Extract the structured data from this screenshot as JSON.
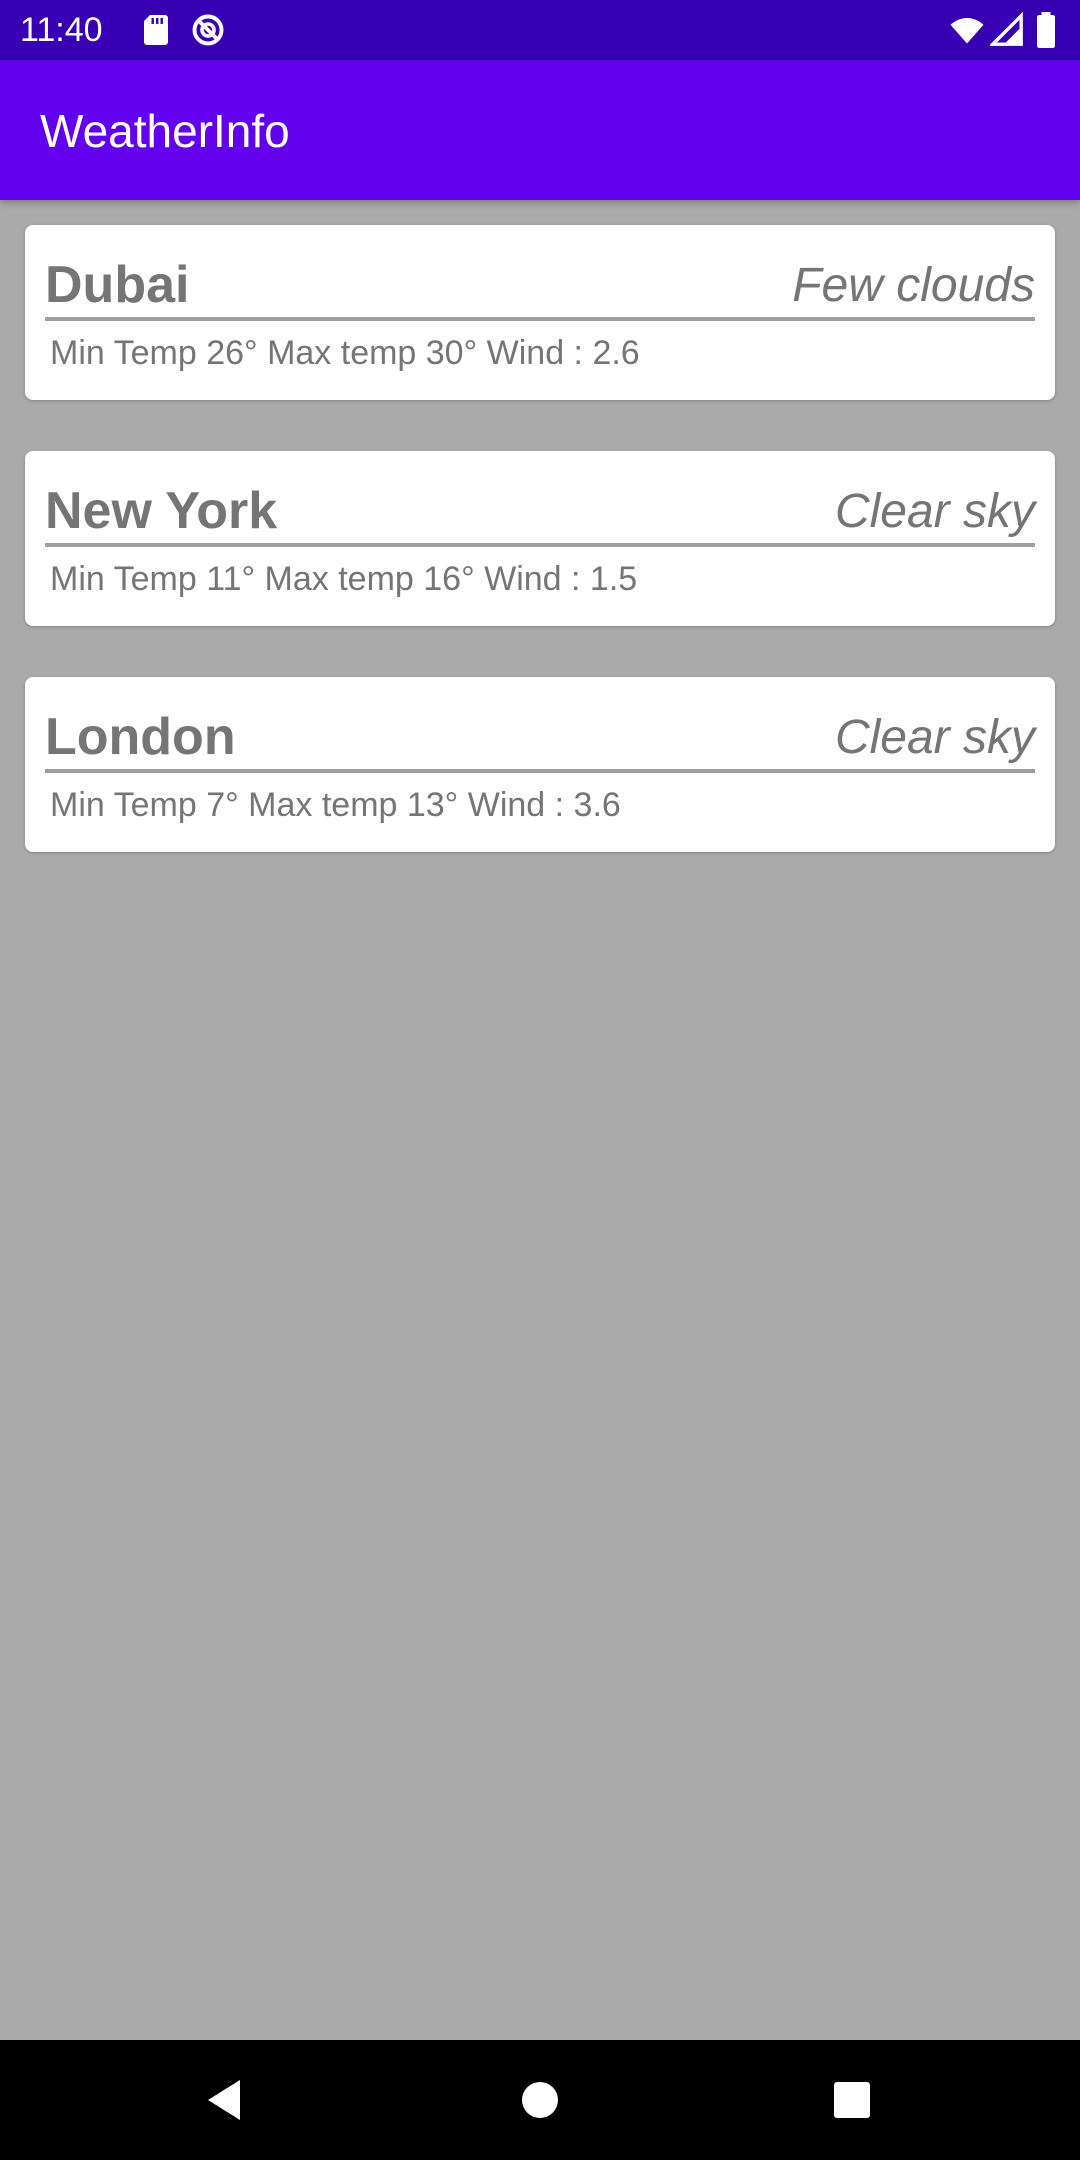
{
  "status_bar": {
    "time": "11:40",
    "left_icons": [
      "sd-card-icon",
      "sync-icon"
    ],
    "right_icons": [
      "wifi-icon",
      "cell-signal-icon",
      "battery-icon"
    ]
  },
  "app_bar": {
    "title": "WeatherInfo"
  },
  "cities": [
    {
      "name": "Dubai",
      "description": "Few clouds",
      "details": "Min Temp 26° Max temp 30° Wind : 2.6"
    },
    {
      "name": "New York",
      "description": "Clear sky",
      "details": "Min Temp 11° Max temp 16° Wind : 1.5"
    },
    {
      "name": "London",
      "description": "Clear sky",
      "details": "Min Temp 7° Max temp 13° Wind : 3.6"
    }
  ],
  "nav_bar": {
    "buttons": [
      "back-icon",
      "home-icon",
      "recents-icon"
    ]
  },
  "colors": {
    "status_bar": "#3700b3",
    "app_bar": "#6200ee",
    "background": "#aaaaaa",
    "card": "#ffffff",
    "text_muted": "#757575"
  }
}
